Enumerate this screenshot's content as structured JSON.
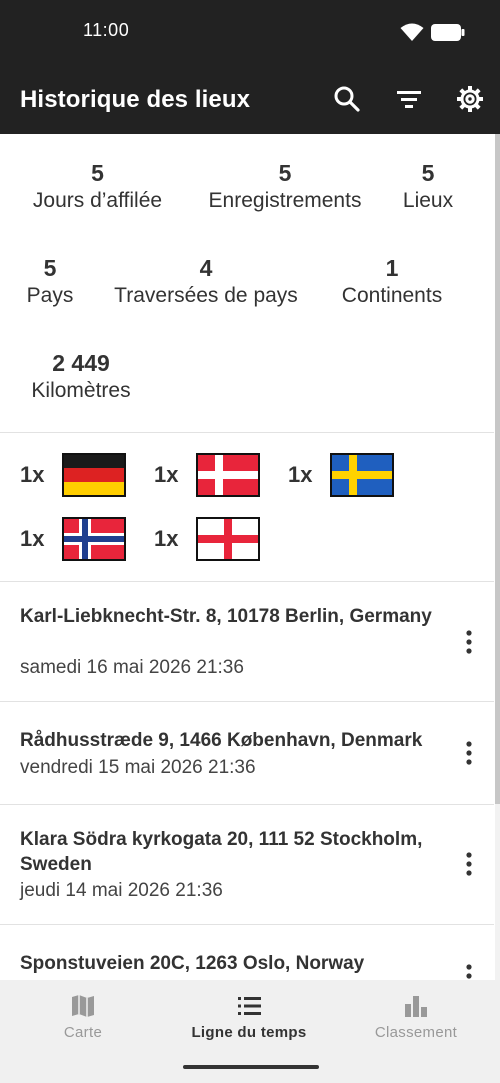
{
  "status_bar": {
    "time": "11:00"
  },
  "app_bar": {
    "title": "Historique des lieux",
    "icons": [
      "search-icon",
      "filter-icon",
      "gear-icon"
    ]
  },
  "stats": [
    {
      "value": "5",
      "label": "Jours d’affilée"
    },
    {
      "value": "5",
      "label": "Enregistrements"
    },
    {
      "value": "5",
      "label": "Lieux"
    },
    {
      "value": "5",
      "label": "Pays"
    },
    {
      "value": "4",
      "label": "Traversées de pays"
    },
    {
      "value": "1",
      "label": "Continents"
    },
    {
      "value": "2 449",
      "label": "Kilomètres"
    }
  ],
  "flags": [
    {
      "count": "1x",
      "country": "germany"
    },
    {
      "count": "1x",
      "country": "denmark"
    },
    {
      "count": "1x",
      "country": "sweden"
    },
    {
      "count": "1x",
      "country": "norway"
    },
    {
      "count": "1x",
      "country": "england"
    }
  ],
  "entries": [
    {
      "address": "Karl-Liebknecht-Str. 8, 10178 Berlin, Germany",
      "date": "samedi 16 mai 2026 21:36"
    },
    {
      "address": "Rådhusstræde 9, 1466 København, Denmark",
      "date": "vendredi 15 mai 2026 21:36"
    },
    {
      "address": "Klara Södra kyrkogata 20, 111 52 Stockholm, Sweden",
      "date": "jeudi 14 mai 2026 21:36"
    },
    {
      "address": "Sponstuveien 20C, 1263 Oslo, Norway",
      "date": ""
    }
  ],
  "bottom_nav": [
    {
      "label": "Carte",
      "icon": "map-icon",
      "active": false
    },
    {
      "label": "Ligne du temps",
      "icon": "list-icon",
      "active": true
    },
    {
      "label": "Classement",
      "icon": "bar-chart-icon",
      "active": false
    }
  ],
  "colors": {
    "app_bar": "#222222",
    "background": "#ffffff",
    "nav_background": "#f0f0f0"
  }
}
